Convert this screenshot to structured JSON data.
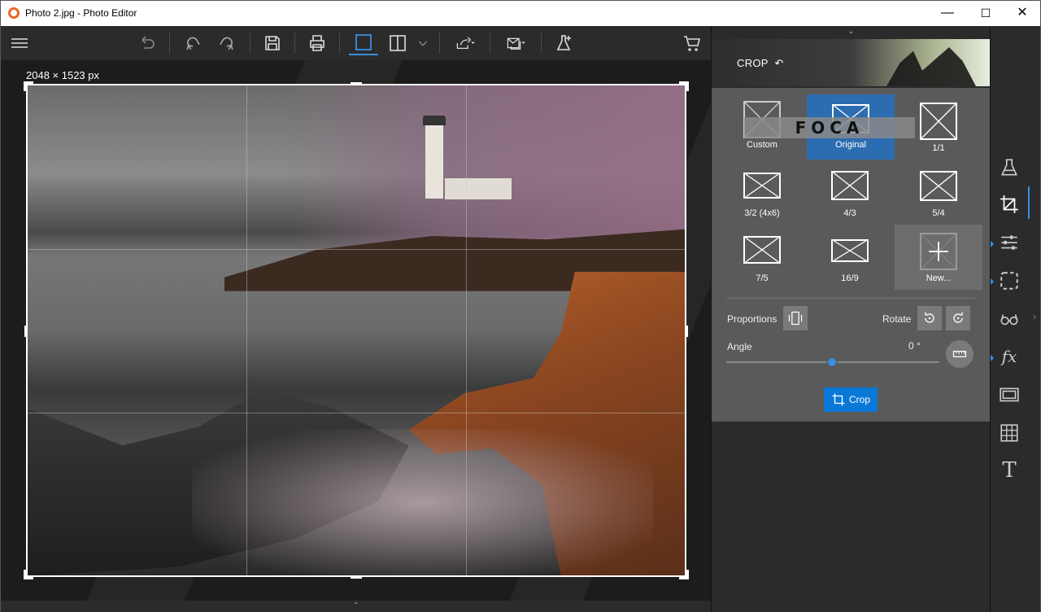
{
  "window": {
    "title": "Photo 2.jpg - Photo Editor",
    "minimize": "—",
    "maximize": "☐",
    "close": "✕"
  },
  "toolbar": {
    "items": [
      "menu-icon",
      "undo-all-icon",
      "undo-icon",
      "redo-icon",
      "save-icon",
      "print-icon",
      "single-view-icon",
      "compare-view-icon",
      "share-icon",
      "batch-icon",
      "effects-lab-icon",
      "cart-icon"
    ]
  },
  "canvas": {
    "size_label": "2048 × 1523 px",
    "collapse_glyph": "⌃"
  },
  "panel": {
    "expand_glyph": "⌄",
    "title": "CROP",
    "ratios": [
      {
        "label": "Custom",
        "selected": false
      },
      {
        "label": "Original",
        "selected": true
      },
      {
        "label": "1/1",
        "selected": false
      },
      {
        "label": "3/2 (4x6)",
        "selected": false
      },
      {
        "label": "4/3",
        "selected": false
      },
      {
        "label": "5/4",
        "selected": false
      },
      {
        "label": "7/5",
        "selected": false
      },
      {
        "label": "16/9",
        "selected": false
      },
      {
        "label": "New...",
        "selected": false
      }
    ],
    "watermark_text": "FOCA",
    "proportions_label": "Proportions",
    "rotate_label": "Rotate",
    "angle_label": "Angle",
    "angle_value": "0 °",
    "angle_position": 0.5,
    "crop_button": "Crop"
  },
  "rail": {
    "items": [
      "lab-flask-icon",
      "crop-icon",
      "adjust-sliders-icon",
      "selection-icon",
      "glasses-icon",
      "fx-icon",
      "frame-icon",
      "texture-icon",
      "text-icon"
    ],
    "active": "crop-icon",
    "fx_label": "fx",
    "text_label": "T"
  },
  "colors": {
    "accent": "#0a78d7",
    "selected_ratio": "#2c6cb0",
    "panel_bg": "#5a5a5a"
  }
}
